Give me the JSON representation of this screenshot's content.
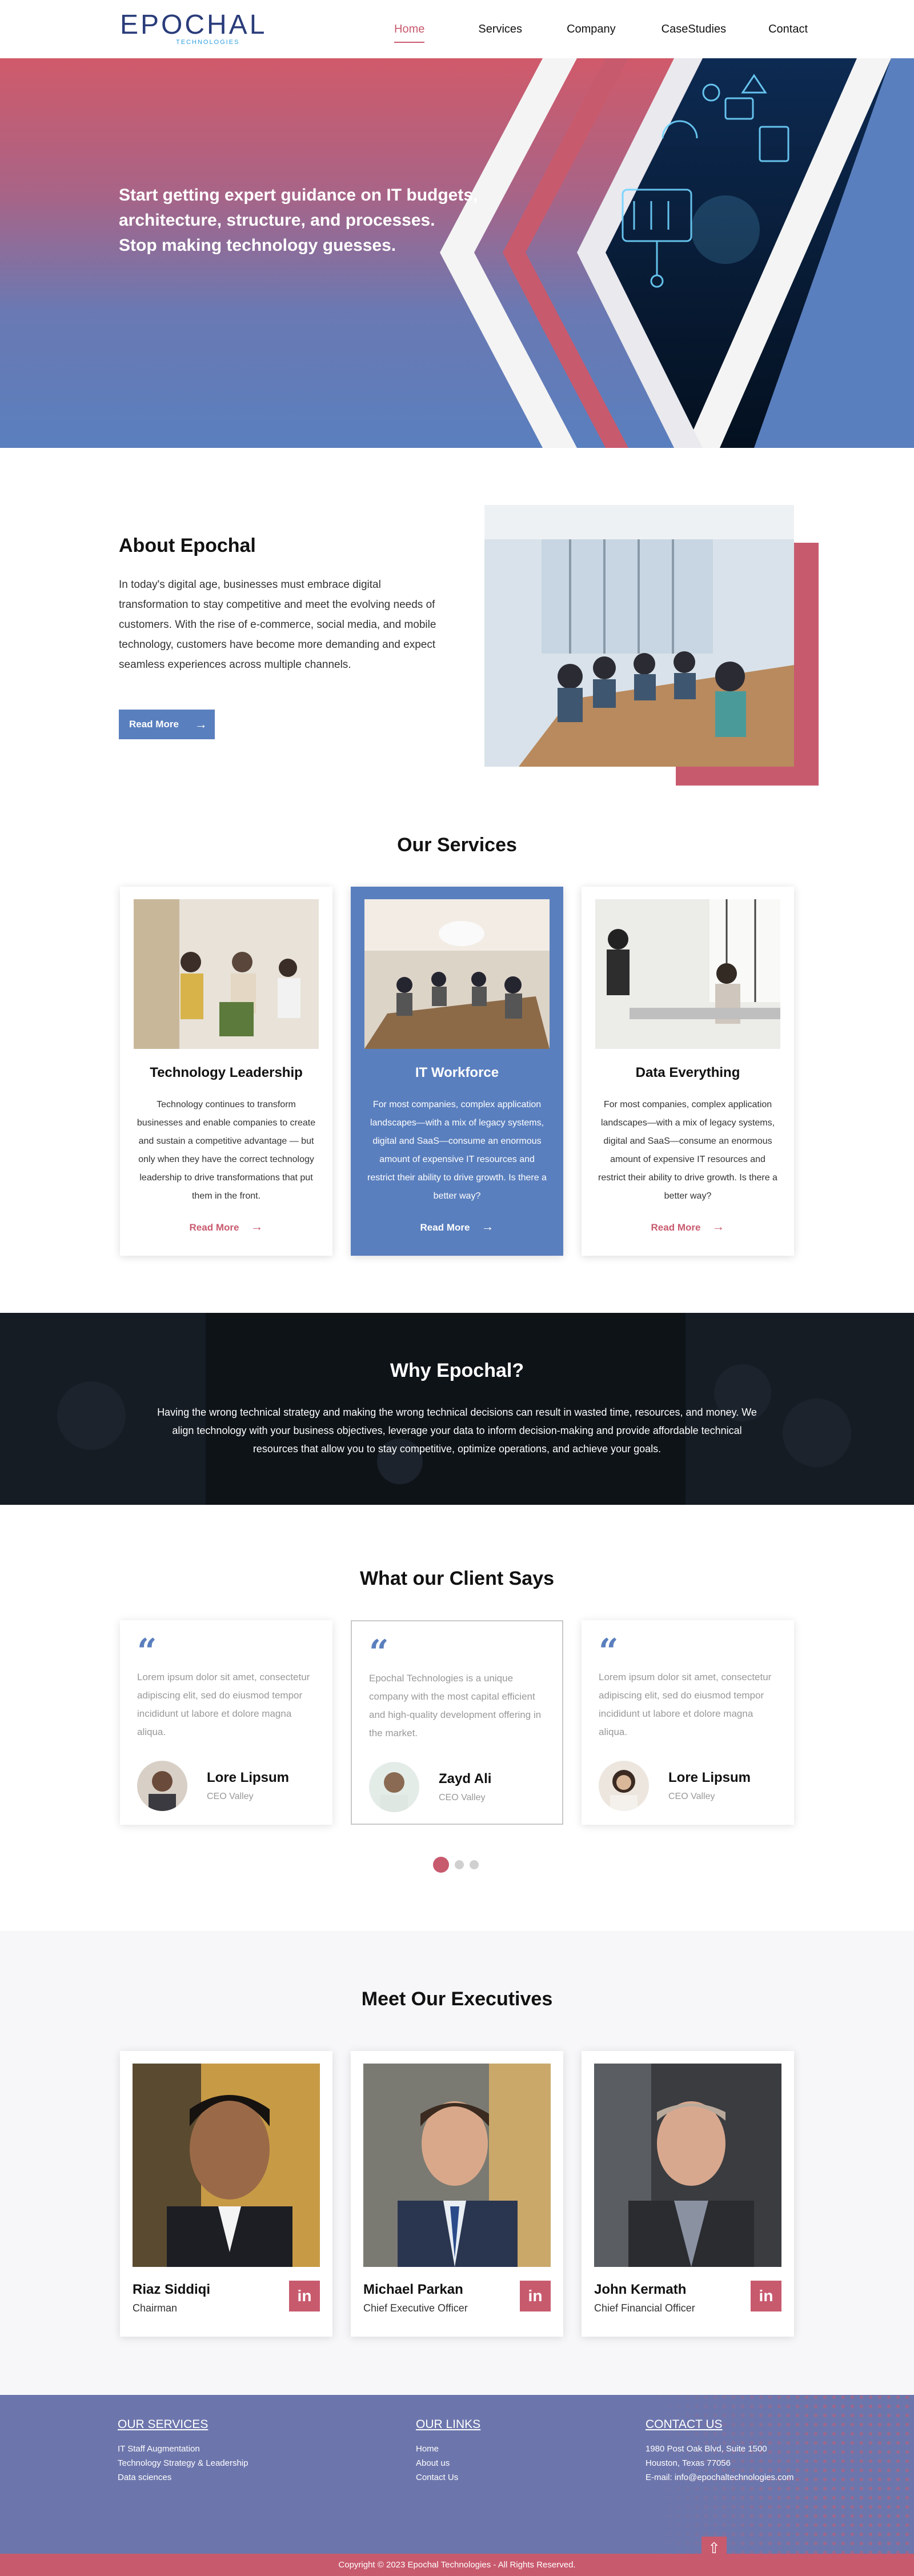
{
  "header": {
    "logo_main": "EPOCHAL",
    "logo_sub": "TECHNOLOGIES",
    "nav": [
      "Home",
      "Services",
      "Company",
      "CaseStudies",
      "Contact"
    ],
    "active_nav": "Home"
  },
  "hero": {
    "lines": [
      "Start getting expert guidance on IT budgets,",
      "architecture, structure, and processes.",
      "Stop making technology guesses."
    ]
  },
  "about": {
    "title": "About Epochal",
    "body": "In today's digital age, businesses must embrace digital transformation to stay competitive and meet the evolving needs of customers. With the rise of e-commerce, social media, and mobile technology, customers have become more demanding and expect seamless experiences across multiple channels.",
    "button": "Read More"
  },
  "services": {
    "title": "Our Services",
    "cards": [
      {
        "title": "Technology Leadership",
        "desc": "Technology continues to transform businesses and enable companies to create and sustain a competitive advantage — but only when they have the correct technology leadership to drive transformations that put them in the front.",
        "more": "Read More"
      },
      {
        "title": "IT Workforce",
        "desc": "For most companies, complex application landscapes—with a mix of legacy systems, digital and SaaS—consume an enormous amount of expensive IT resources and restrict their ability to drive growth.  Is there a better way?",
        "more": "Read More"
      },
      {
        "title": "Data Everything",
        "desc": "For most companies, complex application landscapes—with a mix of legacy systems, digital and SaaS—consume an enormous amount of expensive IT resources and restrict their ability to drive growth.  Is there a better way?",
        "more": "Read More"
      }
    ]
  },
  "why": {
    "title": "Why Epochal?",
    "text": "Having the wrong technical strategy and making the wrong technical decisions can result in wasted time, resources, and money. We align technology with your business objectives, leverage your data to inform decision-making and provide affordable technical resources that allow you to stay competitive, optimize operations, and achieve your goals."
  },
  "testimonials": {
    "title": "What our Client Says",
    "items": [
      {
        "text": "Lorem ipsum dolor sit amet, consectetur adipiscing elit, sed do eiusmod tempor incididunt ut labore et dolore magna aliqua.",
        "name": "Lore Lipsum",
        "role": "CEO Valley"
      },
      {
        "text": "Epochal Technologies is a unique company with the most capital efficient and high-quality development offering in the market.",
        "name": "Zayd Ali",
        "role": "CEO Valley"
      },
      {
        "text": "Lorem ipsum dolor sit amet, consectetur adipiscing elit, sed do eiusmod tempor incididunt ut labore et dolore magna aliqua.",
        "name": "Lore Lipsum",
        "role": "CEO Valley"
      }
    ],
    "active_slide": 1,
    "slide_count": 3
  },
  "executives": {
    "title": "Meet Our Executives",
    "items": [
      {
        "name": "Riaz Siddiqi",
        "role": "Chairman"
      },
      {
        "name": "Michael Parkan",
        "role": "Chief Executive Officer"
      },
      {
        "name": "John Kermath",
        "role": "Chief Financial Officer"
      }
    ],
    "social_icon": "in"
  },
  "footer": {
    "services_title": "OUR SERVICES",
    "services": [
      "IT Staff Augmentation",
      "Technology Strategy & Leadership",
      "Data sciences"
    ],
    "links_title": "OUR LINKS",
    "links": [
      "Home",
      "About us",
      "Contact Us"
    ],
    "contact_title": "CONTACT US",
    "contact": [
      "1980 Post Oak Blvd, Suite 1500",
      "Houston, Texas 77056",
      "E-mail: info@epochaltechnologies.com"
    ],
    "copyright": "Copyright © 2023 Epochal Technologies - All Rights Reserved.",
    "to_top_icon": "arrow-up-icon"
  },
  "colors": {
    "accent_pink": "#c85a6e",
    "accent_blue": "#5a7fbe",
    "footer_blue": "#6d76ac",
    "dark": "#10151c"
  }
}
